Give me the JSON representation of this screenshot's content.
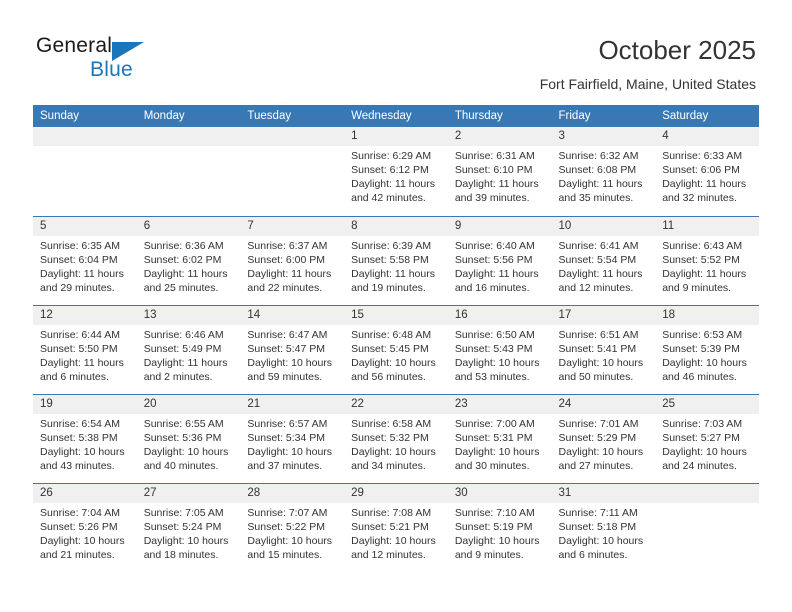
{
  "brand": {
    "name_part1": "General",
    "name_part2": "Blue",
    "accent_color": "#1b75bb"
  },
  "header": {
    "title": "October 2025",
    "subtitle": "Fort Fairfield, Maine, United States",
    "header_bg_color": "#3878b4"
  },
  "weekdays": [
    "Sunday",
    "Monday",
    "Tuesday",
    "Wednesday",
    "Thursday",
    "Friday",
    "Saturday"
  ],
  "labels": {
    "sunrise_prefix": "Sunrise:",
    "sunset_prefix": "Sunset:",
    "daylight_prefix": "Daylight:"
  },
  "weeks": [
    [
      {
        "day": "",
        "sunrise": "",
        "sunset": "",
        "daylight_line1": "",
        "daylight_line2": ""
      },
      {
        "day": "",
        "sunrise": "",
        "sunset": "",
        "daylight_line1": "",
        "daylight_line2": ""
      },
      {
        "day": "",
        "sunrise": "",
        "sunset": "",
        "daylight_line1": "",
        "daylight_line2": ""
      },
      {
        "day": "1",
        "sunrise": "Sunrise: 6:29 AM",
        "sunset": "Sunset: 6:12 PM",
        "daylight_line1": "Daylight: 11 hours",
        "daylight_line2": "and 42 minutes."
      },
      {
        "day": "2",
        "sunrise": "Sunrise: 6:31 AM",
        "sunset": "Sunset: 6:10 PM",
        "daylight_line1": "Daylight: 11 hours",
        "daylight_line2": "and 39 minutes."
      },
      {
        "day": "3",
        "sunrise": "Sunrise: 6:32 AM",
        "sunset": "Sunset: 6:08 PM",
        "daylight_line1": "Daylight: 11 hours",
        "daylight_line2": "and 35 minutes."
      },
      {
        "day": "4",
        "sunrise": "Sunrise: 6:33 AM",
        "sunset": "Sunset: 6:06 PM",
        "daylight_line1": "Daylight: 11 hours",
        "daylight_line2": "and 32 minutes."
      }
    ],
    [
      {
        "day": "5",
        "sunrise": "Sunrise: 6:35 AM",
        "sunset": "Sunset: 6:04 PM",
        "daylight_line1": "Daylight: 11 hours",
        "daylight_line2": "and 29 minutes."
      },
      {
        "day": "6",
        "sunrise": "Sunrise: 6:36 AM",
        "sunset": "Sunset: 6:02 PM",
        "daylight_line1": "Daylight: 11 hours",
        "daylight_line2": "and 25 minutes."
      },
      {
        "day": "7",
        "sunrise": "Sunrise: 6:37 AM",
        "sunset": "Sunset: 6:00 PM",
        "daylight_line1": "Daylight: 11 hours",
        "daylight_line2": "and 22 minutes."
      },
      {
        "day": "8",
        "sunrise": "Sunrise: 6:39 AM",
        "sunset": "Sunset: 5:58 PM",
        "daylight_line1": "Daylight: 11 hours",
        "daylight_line2": "and 19 minutes."
      },
      {
        "day": "9",
        "sunrise": "Sunrise: 6:40 AM",
        "sunset": "Sunset: 5:56 PM",
        "daylight_line1": "Daylight: 11 hours",
        "daylight_line2": "and 16 minutes."
      },
      {
        "day": "10",
        "sunrise": "Sunrise: 6:41 AM",
        "sunset": "Sunset: 5:54 PM",
        "daylight_line1": "Daylight: 11 hours",
        "daylight_line2": "and 12 minutes."
      },
      {
        "day": "11",
        "sunrise": "Sunrise: 6:43 AM",
        "sunset": "Sunset: 5:52 PM",
        "daylight_line1": "Daylight: 11 hours",
        "daylight_line2": "and 9 minutes."
      }
    ],
    [
      {
        "day": "12",
        "sunrise": "Sunrise: 6:44 AM",
        "sunset": "Sunset: 5:50 PM",
        "daylight_line1": "Daylight: 11 hours",
        "daylight_line2": "and 6 minutes."
      },
      {
        "day": "13",
        "sunrise": "Sunrise: 6:46 AM",
        "sunset": "Sunset: 5:49 PM",
        "daylight_line1": "Daylight: 11 hours",
        "daylight_line2": "and 2 minutes."
      },
      {
        "day": "14",
        "sunrise": "Sunrise: 6:47 AM",
        "sunset": "Sunset: 5:47 PM",
        "daylight_line1": "Daylight: 10 hours",
        "daylight_line2": "and 59 minutes."
      },
      {
        "day": "15",
        "sunrise": "Sunrise: 6:48 AM",
        "sunset": "Sunset: 5:45 PM",
        "daylight_line1": "Daylight: 10 hours",
        "daylight_line2": "and 56 minutes."
      },
      {
        "day": "16",
        "sunrise": "Sunrise: 6:50 AM",
        "sunset": "Sunset: 5:43 PM",
        "daylight_line1": "Daylight: 10 hours",
        "daylight_line2": "and 53 minutes."
      },
      {
        "day": "17",
        "sunrise": "Sunrise: 6:51 AM",
        "sunset": "Sunset: 5:41 PM",
        "daylight_line1": "Daylight: 10 hours",
        "daylight_line2": "and 50 minutes."
      },
      {
        "day": "18",
        "sunrise": "Sunrise: 6:53 AM",
        "sunset": "Sunset: 5:39 PM",
        "daylight_line1": "Daylight: 10 hours",
        "daylight_line2": "and 46 minutes."
      }
    ],
    [
      {
        "day": "19",
        "sunrise": "Sunrise: 6:54 AM",
        "sunset": "Sunset: 5:38 PM",
        "daylight_line1": "Daylight: 10 hours",
        "daylight_line2": "and 43 minutes."
      },
      {
        "day": "20",
        "sunrise": "Sunrise: 6:55 AM",
        "sunset": "Sunset: 5:36 PM",
        "daylight_line1": "Daylight: 10 hours",
        "daylight_line2": "and 40 minutes."
      },
      {
        "day": "21",
        "sunrise": "Sunrise: 6:57 AM",
        "sunset": "Sunset: 5:34 PM",
        "daylight_line1": "Daylight: 10 hours",
        "daylight_line2": "and 37 minutes."
      },
      {
        "day": "22",
        "sunrise": "Sunrise: 6:58 AM",
        "sunset": "Sunset: 5:32 PM",
        "daylight_line1": "Daylight: 10 hours",
        "daylight_line2": "and 34 minutes."
      },
      {
        "day": "23",
        "sunrise": "Sunrise: 7:00 AM",
        "sunset": "Sunset: 5:31 PM",
        "daylight_line1": "Daylight: 10 hours",
        "daylight_line2": "and 30 minutes."
      },
      {
        "day": "24",
        "sunrise": "Sunrise: 7:01 AM",
        "sunset": "Sunset: 5:29 PM",
        "daylight_line1": "Daylight: 10 hours",
        "daylight_line2": "and 27 minutes."
      },
      {
        "day": "25",
        "sunrise": "Sunrise: 7:03 AM",
        "sunset": "Sunset: 5:27 PM",
        "daylight_line1": "Daylight: 10 hours",
        "daylight_line2": "and 24 minutes."
      }
    ],
    [
      {
        "day": "26",
        "sunrise": "Sunrise: 7:04 AM",
        "sunset": "Sunset: 5:26 PM",
        "daylight_line1": "Daylight: 10 hours",
        "daylight_line2": "and 21 minutes."
      },
      {
        "day": "27",
        "sunrise": "Sunrise: 7:05 AM",
        "sunset": "Sunset: 5:24 PM",
        "daylight_line1": "Daylight: 10 hours",
        "daylight_line2": "and 18 minutes."
      },
      {
        "day": "28",
        "sunrise": "Sunrise: 7:07 AM",
        "sunset": "Sunset: 5:22 PM",
        "daylight_line1": "Daylight: 10 hours",
        "daylight_line2": "and 15 minutes."
      },
      {
        "day": "29",
        "sunrise": "Sunrise: 7:08 AM",
        "sunset": "Sunset: 5:21 PM",
        "daylight_line1": "Daylight: 10 hours",
        "daylight_line2": "and 12 minutes."
      },
      {
        "day": "30",
        "sunrise": "Sunrise: 7:10 AM",
        "sunset": "Sunset: 5:19 PM",
        "daylight_line1": "Daylight: 10 hours",
        "daylight_line2": "and 9 minutes."
      },
      {
        "day": "31",
        "sunrise": "Sunrise: 7:11 AM",
        "sunset": "Sunset: 5:18 PM",
        "daylight_line1": "Daylight: 10 hours",
        "daylight_line2": "and 6 minutes."
      },
      {
        "day": "",
        "sunrise": "",
        "sunset": "",
        "daylight_line1": "",
        "daylight_line2": ""
      }
    ]
  ]
}
